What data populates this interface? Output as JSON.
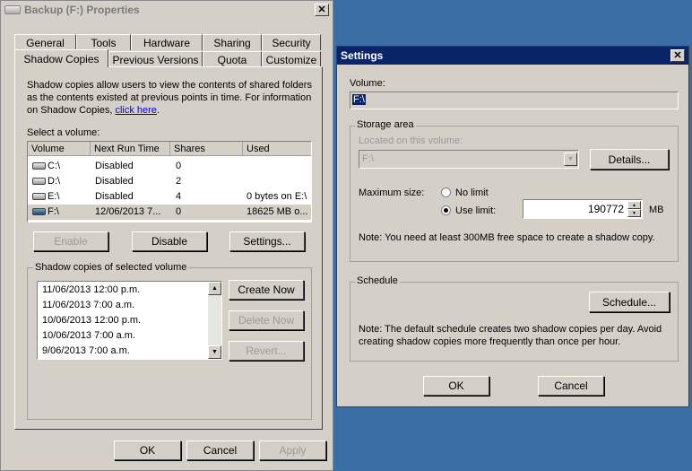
{
  "props": {
    "title": "Backup (F:) Properties",
    "tabs_row1": [
      "General",
      "Tools",
      "Hardware",
      "Sharing",
      "Security"
    ],
    "tabs_row2": [
      "Shadow Copies",
      "Previous Versions",
      "Quota",
      "Customize"
    ],
    "intro_text": "Shadow copies allow users to view the contents of shared folders as the contents existed at previous points in time. For information on Shadow Copies, ",
    "intro_link": "click here",
    "intro_end": ".",
    "select_volume_label": "Select a volume:",
    "columns": [
      "Volume",
      "Next Run Time",
      "Shares",
      "Used"
    ],
    "volumes": [
      {
        "volume": "C:\\",
        "next_run": "Disabled",
        "shares": "0",
        "used": ""
      },
      {
        "volume": "D:\\",
        "next_run": "Disabled",
        "shares": "2",
        "used": ""
      },
      {
        "volume": "E:\\",
        "next_run": "Disabled",
        "shares": "4",
        "used": "0 bytes on E:\\"
      },
      {
        "volume": "F:\\",
        "next_run": "12/06/2013 7...",
        "shares": "0",
        "used": "18625 MB o..."
      }
    ],
    "enable_label": "Enable",
    "disable_label": "Disable",
    "settings_label": "Settings...",
    "shadow_group_label": "Shadow copies of selected volume",
    "shadow_copies": [
      "11/06/2013 12:00 p.m.",
      "11/06/2013 7:00 a.m.",
      "10/06/2013 12:00 p.m.",
      "10/06/2013 7:00 a.m.",
      "9/06/2013 7:00 a.m."
    ],
    "create_now_label": "Create Now",
    "delete_now_label": "Delete Now",
    "revert_label": "Revert...",
    "ok_label": "OK",
    "cancel_label": "Cancel",
    "apply_label": "Apply"
  },
  "settings": {
    "title": "Settings",
    "volume_label": "Volume:",
    "volume_value": "F:\\",
    "storage_group": "Storage area",
    "located_label": "Located on this volume:",
    "located_value": "F:\\",
    "details_label": "Details...",
    "max_size_label": "Maximum size:",
    "no_limit_label": "No limit",
    "use_limit_label": "Use limit:",
    "limit_value": "190772",
    "limit_unit": "MB",
    "storage_note": "Note: You need at least 300MB free space to create a shadow copy.",
    "schedule_group": "Schedule",
    "schedule_label": "Schedule...",
    "schedule_note": "Note: The default schedule creates two shadow copies per day. Avoid creating shadow copies more frequently than once per hour.",
    "ok_label": "OK",
    "cancel_label": "Cancel"
  },
  "icons": {
    "close": "close-icon",
    "drive": "drive-icon",
    "app": "drive-app-icon"
  }
}
